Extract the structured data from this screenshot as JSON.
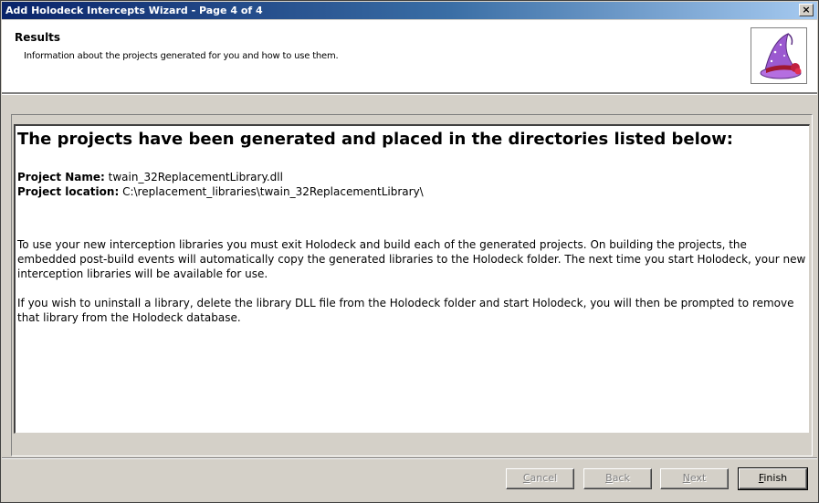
{
  "window": {
    "title": "Add Holodeck Intercepts Wizard - Page 4 of 4",
    "close_label": "×"
  },
  "header": {
    "title": "Results",
    "subtitle": "Information about the projects generated for you and how to use them.",
    "logo_icon": "wizard-hat-icon"
  },
  "content": {
    "heading": "The projects have been generated and placed in the directories listed below:",
    "project_name_label": "Project Name:",
    "project_name_value": "twain_32ReplacementLibrary.dll",
    "project_location_label": "Project location:",
    "project_location_value": "C:\\replacement_libraries\\twain_32ReplacementLibrary\\",
    "paragraph1": "To use your new interception libraries you must exit Holodeck and build each of the generated projects. On building the projects, the embedded post-build events will automatically copy the generated libraries to the Holodeck folder. The next time you start Holodeck, your new interception libraries will be available for use.",
    "paragraph2": "If you wish to uninstall a library, delete the library DLL file from the Holodeck folder and start Holodeck, you will then be prompted to remove that library from the Holodeck database."
  },
  "buttons": {
    "cancel_hot": "C",
    "cancel_rest": "ancel",
    "back_hot": "B",
    "back_rest": "ack",
    "next_hot": "N",
    "next_rest": "ext",
    "finish_hot": "F",
    "finish_rest": "inish"
  }
}
